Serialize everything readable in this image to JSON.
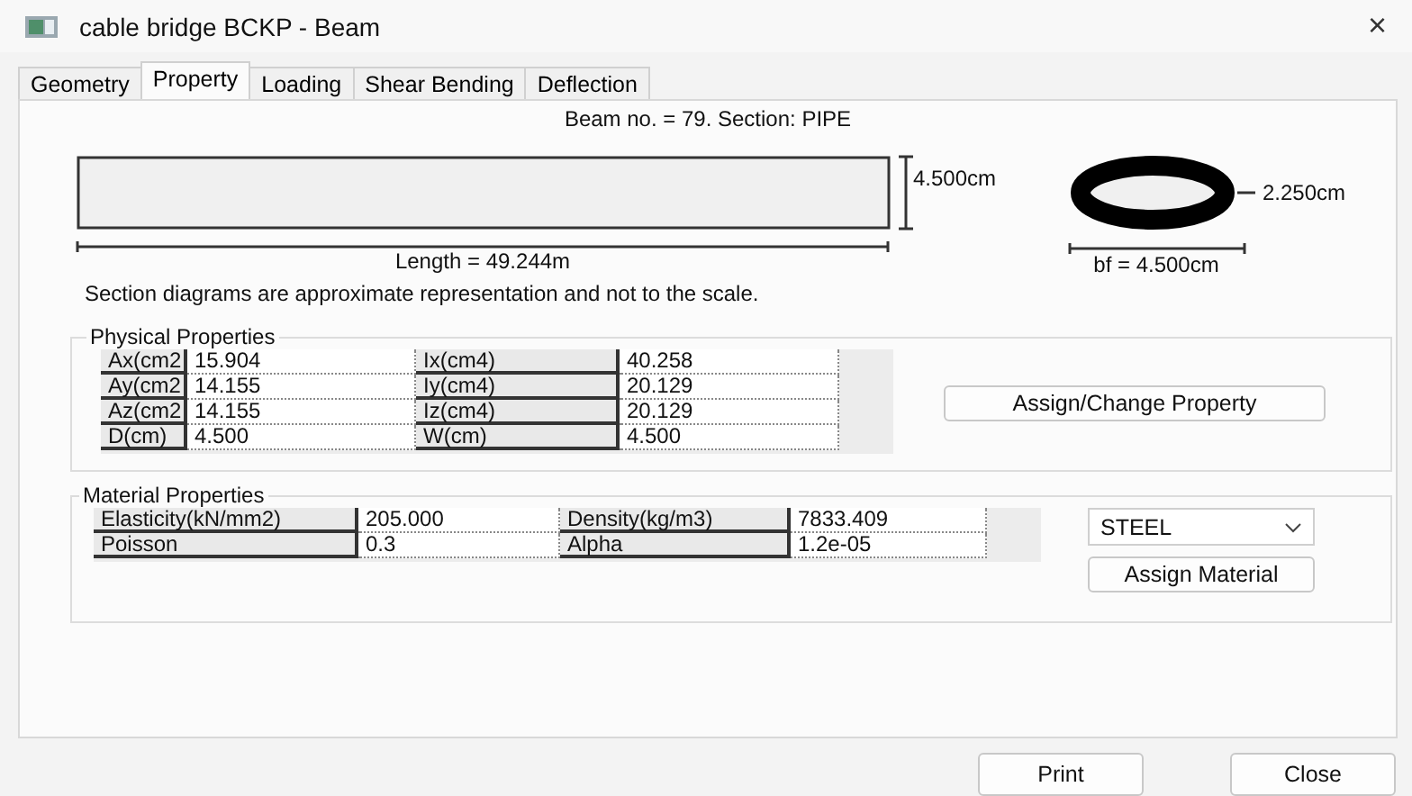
{
  "window": {
    "title": "cable bridge BCKP - Beam",
    "close": "×"
  },
  "tabs": [
    {
      "label": "Geometry",
      "selected": false
    },
    {
      "label": "Property",
      "selected": true
    },
    {
      "label": "Loading",
      "selected": false
    },
    {
      "label": "Shear Bending",
      "selected": false
    },
    {
      "label": "Deflection",
      "selected": false
    }
  ],
  "header": "Beam no. = 79. Section: PIPE",
  "diagram": {
    "height_label": "4.500cm",
    "length_label": "Length = 49.244m",
    "radius_label": "2.250cm",
    "width_label": "bf = 4.500cm"
  },
  "note": "Section diagrams are approximate representation and not to the scale.",
  "physical": {
    "title": "Physical Properties",
    "rows": [
      [
        "Ax(cm2",
        "15.904",
        "Ix(cm4)",
        "40.258"
      ],
      [
        "Ay(cm2",
        "14.155",
        "Iy(cm4)",
        "20.129"
      ],
      [
        "Az(cm2",
        "14.155",
        "Iz(cm4)",
        "20.129"
      ],
      [
        "D(cm)",
        "4.500",
        "W(cm)",
        "4.500"
      ]
    ],
    "button": "Assign/Change Property"
  },
  "material": {
    "title": "Material Properties",
    "rows": [
      [
        "Elasticity(kN/mm2)",
        "205.000",
        "Density(kg/m3)",
        "7833.409"
      ],
      [
        "Poisson",
        "0.3",
        "Alpha",
        "1.2e-05"
      ]
    ],
    "material": "STEEL",
    "button": "Assign Material"
  },
  "buttons": [
    "Print",
    "Close"
  ]
}
